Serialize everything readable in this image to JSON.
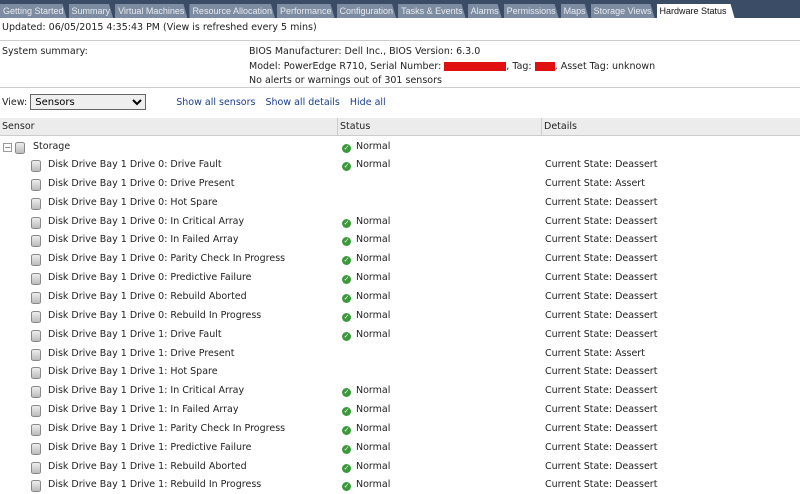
{
  "tabs": [
    "Getting Started",
    "Summary",
    "Virtual Machines",
    "Resource Allocation",
    "Performance",
    "Configuration",
    "Tasks & Events",
    "Alarms",
    "Permissions",
    "Maps",
    "Storage Views",
    "Hardware Status"
  ],
  "active_tab": "Hardware Status",
  "updated": "Updated: 06/05/2015  4:35:43 PM (View is refreshed every 5 mins)",
  "summary": {
    "label": "System summary:",
    "line1": "BIOS Manufacturer: Dell Inc., BIOS Version: 6.3.0",
    "line2_a": "Model: PowerEdge R710, Serial Number:",
    "line2_b": ", Tag:",
    "line2_c": ",  Asset Tag: unknown",
    "line3": "No alerts or warnings out of 301 sensors"
  },
  "view": {
    "label": "View:",
    "value": "Sensors",
    "links": [
      "Show all sensors",
      "Show all details",
      "Hide all"
    ]
  },
  "columns": [
    "Sensor",
    "Status",
    "Details"
  ],
  "group": {
    "name": "Storage",
    "status": "Normal"
  },
  "rows": [
    [
      "Disk Drive Bay 1 Drive 0: Drive Fault",
      "Normal",
      "Current State: Deassert"
    ],
    [
      "Disk Drive Bay 1 Drive 0: Drive Present",
      "",
      "Current State: Assert"
    ],
    [
      "Disk Drive Bay 1 Drive 0: Hot Spare",
      "",
      "Current State: Deassert"
    ],
    [
      "Disk Drive Bay 1 Drive 0: In Critical Array",
      "Normal",
      "Current State: Deassert"
    ],
    [
      "Disk Drive Bay 1 Drive 0: In Failed Array",
      "Normal",
      "Current State: Deassert"
    ],
    [
      "Disk Drive Bay 1 Drive 0: Parity Check In Progress",
      "Normal",
      "Current State: Deassert"
    ],
    [
      "Disk Drive Bay 1 Drive 0: Predictive Failure",
      "Normal",
      "Current State: Deassert"
    ],
    [
      "Disk Drive Bay 1 Drive 0: Rebuild Aborted",
      "Normal",
      "Current State: Deassert"
    ],
    [
      "Disk Drive Bay 1 Drive 0: Rebuild In Progress",
      "Normal",
      "Current State: Deassert"
    ],
    [
      "Disk Drive Bay 1 Drive 1: Drive Fault",
      "Normal",
      "Current State: Deassert"
    ],
    [
      "Disk Drive Bay 1 Drive 1: Drive Present",
      "",
      "Current State: Assert"
    ],
    [
      "Disk Drive Bay 1 Drive 1: Hot Spare",
      "",
      "Current State: Deassert"
    ],
    [
      "Disk Drive Bay 1 Drive 1: In Critical Array",
      "Normal",
      "Current State: Deassert"
    ],
    [
      "Disk Drive Bay 1 Drive 1: In Failed Array",
      "Normal",
      "Current State: Deassert"
    ],
    [
      "Disk Drive Bay 1 Drive 1: Parity Check In Progress",
      "Normal",
      "Current State: Deassert"
    ],
    [
      "Disk Drive Bay 1 Drive 1: Predictive Failure",
      "Normal",
      "Current State: Deassert"
    ],
    [
      "Disk Drive Bay 1 Drive 1: Rebuild Aborted",
      "Normal",
      "Current State: Deassert"
    ],
    [
      "Disk Drive Bay 1 Drive 1: Rebuild In Progress",
      "Normal",
      "Current State: Deassert"
    ]
  ]
}
